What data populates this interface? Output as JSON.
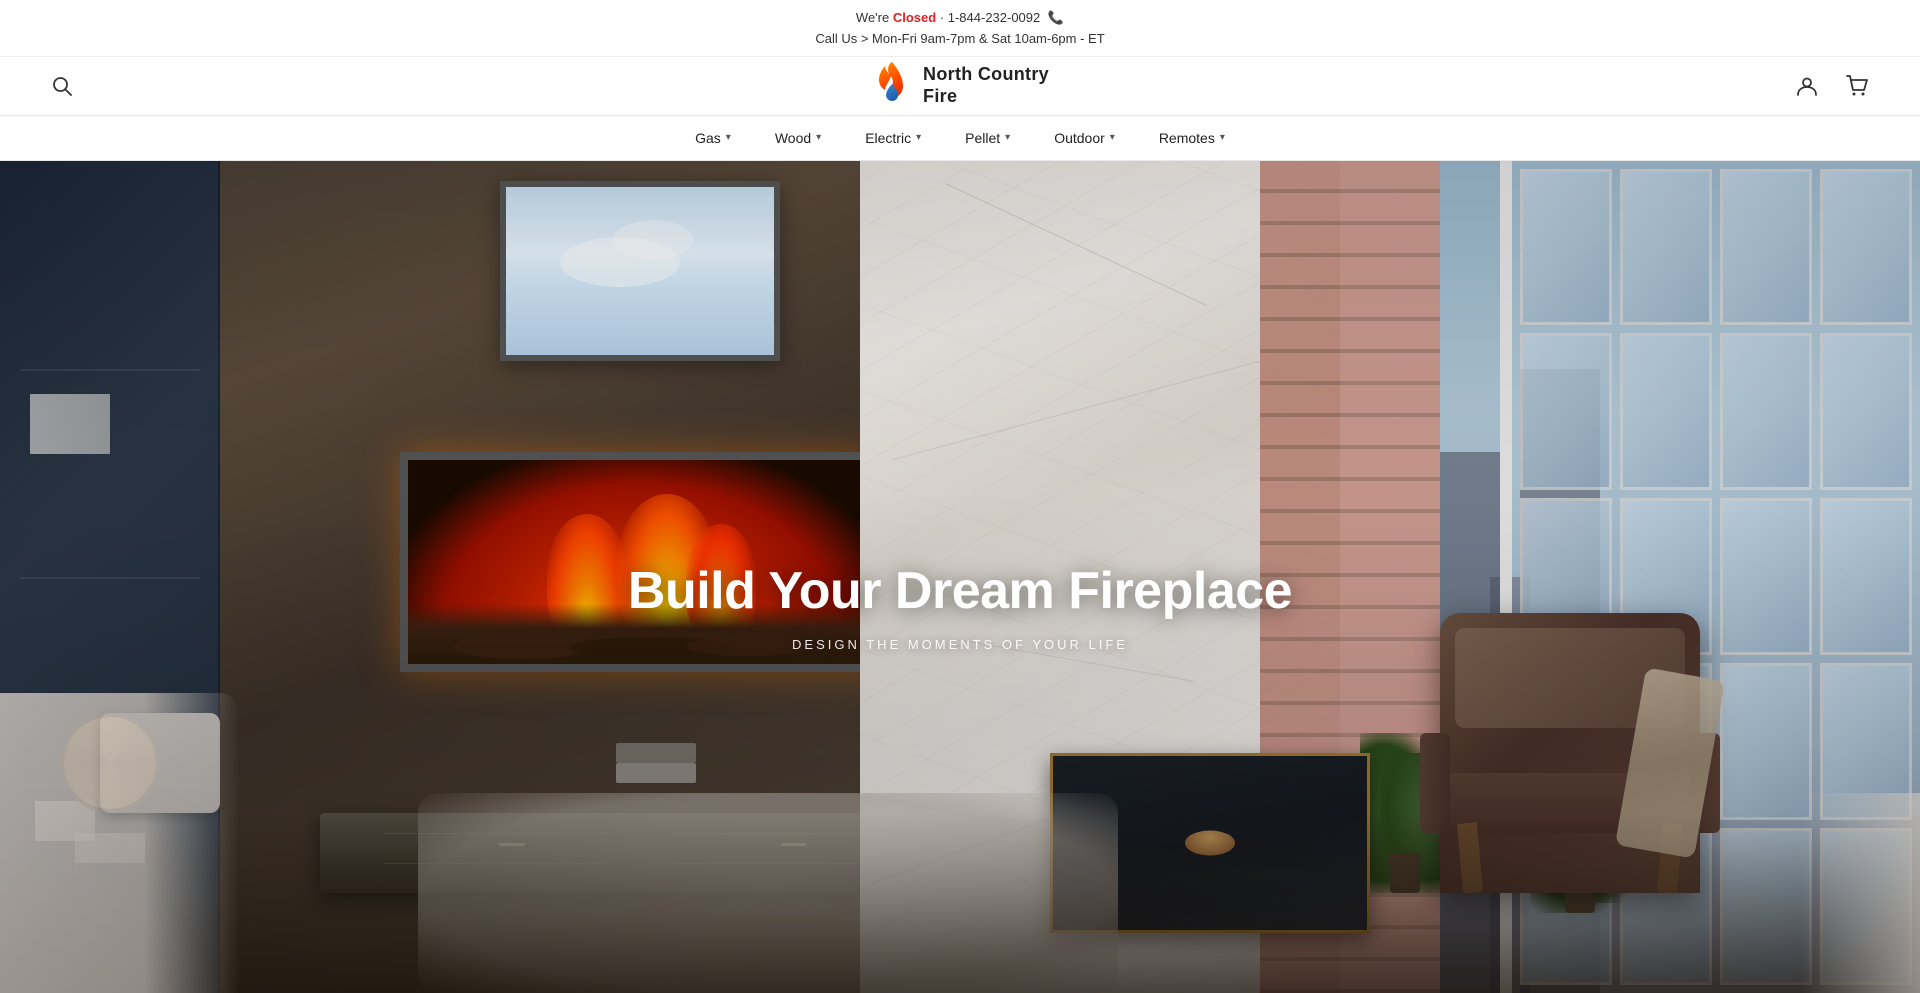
{
  "announcement": {
    "prefix": "We're ",
    "status": "Closed",
    "separator": " · ",
    "phone": "1-844-232-0092",
    "call_hours": "Call Us > Mon-Fri 9am-7pm & Sat 10am-6pm - ET"
  },
  "header": {
    "search_label": "Search",
    "logo_line1": "North Country",
    "logo_line2": "Fire",
    "account_label": "Account",
    "cart_label": "Cart"
  },
  "nav": {
    "items": [
      {
        "label": "Gas",
        "has_dropdown": true
      },
      {
        "label": "Wood",
        "has_dropdown": true
      },
      {
        "label": "Electric",
        "has_dropdown": true
      },
      {
        "label": "Pellet",
        "has_dropdown": true
      },
      {
        "label": "Outdoor",
        "has_dropdown": true
      },
      {
        "label": "Remotes",
        "has_dropdown": true
      }
    ]
  },
  "hero": {
    "title": "Build Your Dream Fireplace",
    "subtitle": "DESIGN THE MOMENTS OF YOUR LIFE"
  },
  "colors": {
    "closed_red": "#e02020",
    "accent_orange": "#ff6000",
    "nav_text": "#222222",
    "hero_text": "#ffffff"
  }
}
